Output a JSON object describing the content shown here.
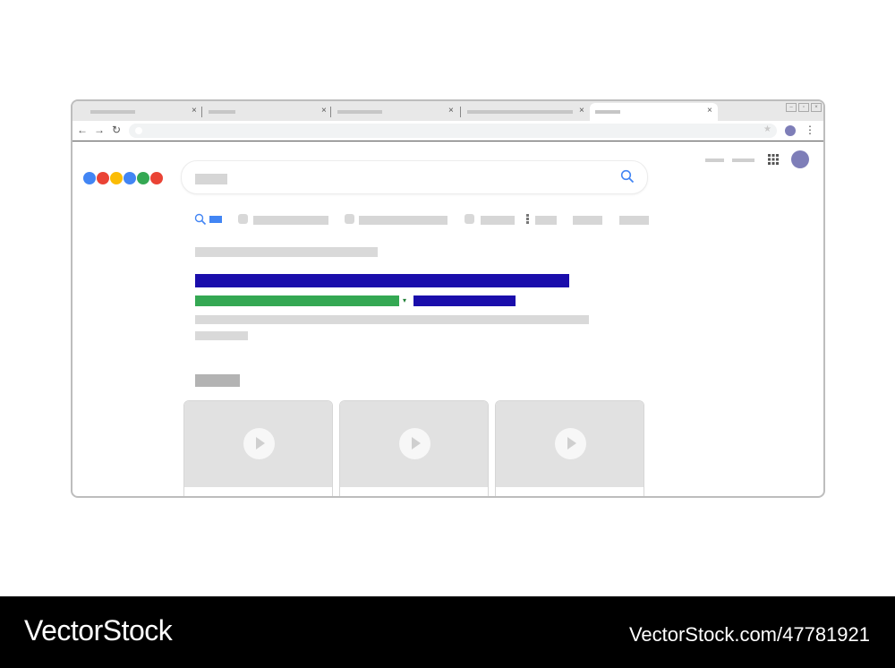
{
  "browser": {
    "tabs": [
      {
        "close_glyph": "×",
        "active": false
      },
      {
        "close_glyph": "×",
        "active": false
      },
      {
        "close_glyph": "×",
        "active": false
      },
      {
        "close_glyph": "×",
        "active": false
      },
      {
        "close_glyph": "×",
        "active": true
      }
    ],
    "window_controls": [
      "minimize-icon",
      "restore-icon",
      "close-icon"
    ],
    "toolbar": {
      "back_glyph": "←",
      "forward_glyph": "→",
      "reload_glyph": "↻",
      "bookmark_glyph": "★",
      "menu_glyph": "⋮"
    }
  },
  "search_page": {
    "logo_dot_colors": [
      "#4285f4",
      "#ea4335",
      "#fbbc05",
      "#4285f4",
      "#34a853",
      "#ea4335"
    ],
    "search_icon": "search-icon",
    "apps_icon": "apps-grid-icon",
    "avatar_color": "#7e7eb8",
    "colors": {
      "link": "#1a0dab",
      "url": "#34a853",
      "placeholder": "#d9d9d9"
    },
    "url_dropdown_glyph": "▾",
    "video_cards": [
      {
        "icon": "play-icon"
      },
      {
        "icon": "play-icon"
      },
      {
        "icon": "play-icon"
      }
    ]
  },
  "watermark": {
    "left": "VectorStock",
    "right": "VectorStock.com/47781921"
  }
}
